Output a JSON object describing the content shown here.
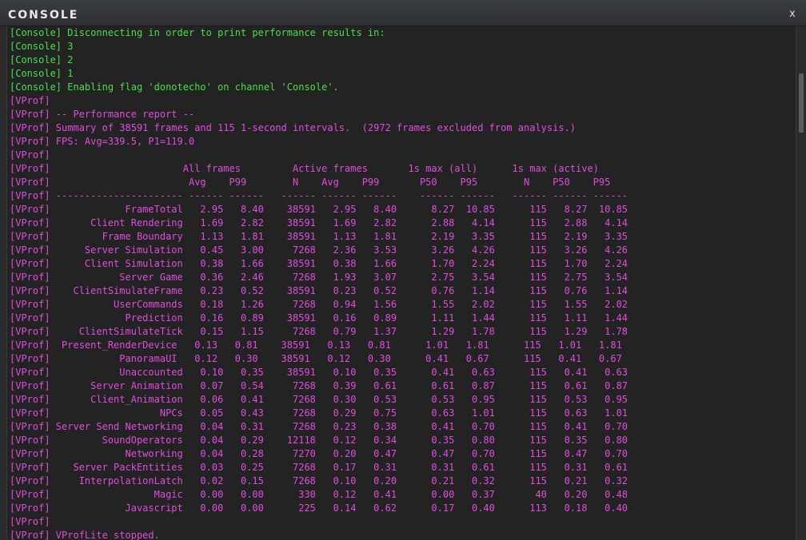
{
  "window": {
    "title": "CONSOLE",
    "close_label": "x"
  },
  "console_lines": [
    {
      "channel": "console",
      "text": "[Console] Disconnecting in order to print performance results in:"
    },
    {
      "channel": "console",
      "text": "[Console] 3"
    },
    {
      "channel": "console",
      "text": "[Console] 2"
    },
    {
      "channel": "console",
      "text": "[Console] 1"
    },
    {
      "channel": "console",
      "text": "[Console] Enabling flag 'donotecho' on channel 'Console'."
    },
    {
      "channel": "vprof",
      "text": "[VProf]"
    },
    {
      "channel": "vprof",
      "text": "[VProf] -- Performance report --"
    },
    {
      "channel": "vprof",
      "text": "[VProf] Summary of 38591 frames and 115 1-second intervals.  (2972 frames excluded from analysis.)"
    },
    {
      "channel": "vprof",
      "text": "[VProf] FPS: Avg=339.5, P1=119.0"
    },
    {
      "channel": "vprof",
      "text": "[VProf]"
    },
    {
      "channel": "vprof",
      "text": "[VProf]                       All frames         Active frames       1s max (all)      1s max (active)"
    },
    {
      "channel": "vprof",
      "text": "[VProf]                        Avg    P99        N    Avg    P99       P50    P95        N    P50    P95"
    },
    {
      "channel": "vprof",
      "text": "[VProf] ---------------------- ------ ------   ------ ------ ------    ------ ------   ------ ------ ------"
    },
    {
      "channel": "vprof",
      "text": "[VProf]             FrameTotal   2.95   8.40    38591   2.95   8.40      8.27  10.85      115   8.27  10.85"
    },
    {
      "channel": "vprof",
      "text": "[VProf]       Client Rendering   1.69   2.82    38591   1.69   2.82      2.88   4.14      115   2.88   4.14"
    },
    {
      "channel": "vprof",
      "text": "[VProf]         Frame Boundary   1.13   1.81    38591   1.13   1.81      2.19   3.35      115   2.19   3.35"
    },
    {
      "channel": "vprof",
      "text": "[VProf]      Server Simulation   0.45   3.00     7268   2.36   3.53      3.26   4.26      115   3.26   4.26"
    },
    {
      "channel": "vprof",
      "text": "[VProf]      Client Simulation   0.38   1.66    38591   0.38   1.66      1.70   2.24      115   1.70   2.24"
    },
    {
      "channel": "vprof",
      "text": "[VProf]            Server Game   0.36   2.46     7268   1.93   3.07      2.75   3.54      115   2.75   3.54"
    },
    {
      "channel": "vprof",
      "text": "[VProf]    ClientSimulateFrame   0.23   0.52    38591   0.23   0.52      0.76   1.14      115   0.76   1.14"
    },
    {
      "channel": "vprof",
      "text": "[VProf]           UserCommands   0.18   1.26     7268   0.94   1.56      1.55   2.02      115   1.55   2.02"
    },
    {
      "channel": "vprof",
      "text": "[VProf]             Prediction   0.16   0.89    38591   0.16   0.89      1.11   1.44      115   1.11   1.44"
    },
    {
      "channel": "vprof",
      "text": "[VProf]     ClientSimulateTick   0.15   1.15     7268   0.79   1.37      1.29   1.78      115   1.29   1.78"
    },
    {
      "channel": "vprof",
      "text": "[VProf]  Present_RenderDevice   0.13   0.81    38591   0.13   0.81      1.01   1.81      115   1.01   1.81"
    },
    {
      "channel": "vprof",
      "text": "[VProf]            PanoramaUI   0.12   0.30    38591   0.12   0.30      0.41   0.67      115   0.41   0.67"
    },
    {
      "channel": "vprof",
      "text": "[VProf]            Unaccounted   0.10   0.35    38591   0.10   0.35      0.41   0.63      115   0.41   0.63"
    },
    {
      "channel": "vprof",
      "text": "[VProf]       Server Animation   0.07   0.54     7268   0.39   0.61      0.61   0.87      115   0.61   0.87"
    },
    {
      "channel": "vprof",
      "text": "[VProf]       Client_Animation   0.06   0.41     7268   0.30   0.53      0.53   0.95      115   0.53   0.95"
    },
    {
      "channel": "vprof",
      "text": "[VProf]                   NPCs   0.05   0.43     7268   0.29   0.75      0.63   1.01      115   0.63   1.01"
    },
    {
      "channel": "vprof",
      "text": "[VProf] Server Send Networking   0.04   0.31     7268   0.23   0.38      0.41   0.70      115   0.41   0.70"
    },
    {
      "channel": "vprof",
      "text": "[VProf]         SoundOperators   0.04   0.29    12118   0.12   0.34      0.35   0.80      115   0.35   0.80"
    },
    {
      "channel": "vprof",
      "text": "[VProf]             Networking   0.04   0.28     7270   0.20   0.47      0.47   0.70      115   0.47   0.70"
    },
    {
      "channel": "vprof",
      "text": "[VProf]    Server PackEntities   0.03   0.25     7268   0.17   0.31      0.31   0.61      115   0.31   0.61"
    },
    {
      "channel": "vprof",
      "text": "[VProf]     InterpolationLatch   0.02   0.15     7268   0.10   0.20      0.21   0.32      115   0.21   0.32"
    },
    {
      "channel": "vprof",
      "text": "[VProf]                  Magic   0.00   0.00      330   0.12   0.41      0.00   0.37       40   0.20   0.48"
    },
    {
      "channel": "vprof",
      "text": "[VProf]             Javascript   0.00   0.00      225   0.14   0.62      0.17   0.40      113   0.18   0.40"
    },
    {
      "channel": "vprof",
      "text": "[VProf]"
    },
    {
      "channel": "vprof",
      "text": "[VProf] VProfLite stopped."
    }
  ],
  "colors": {
    "console_text": "#48e048",
    "vprof_text": "#e14ce0",
    "background": "#232323"
  },
  "icons": {
    "close": "close-icon"
  }
}
